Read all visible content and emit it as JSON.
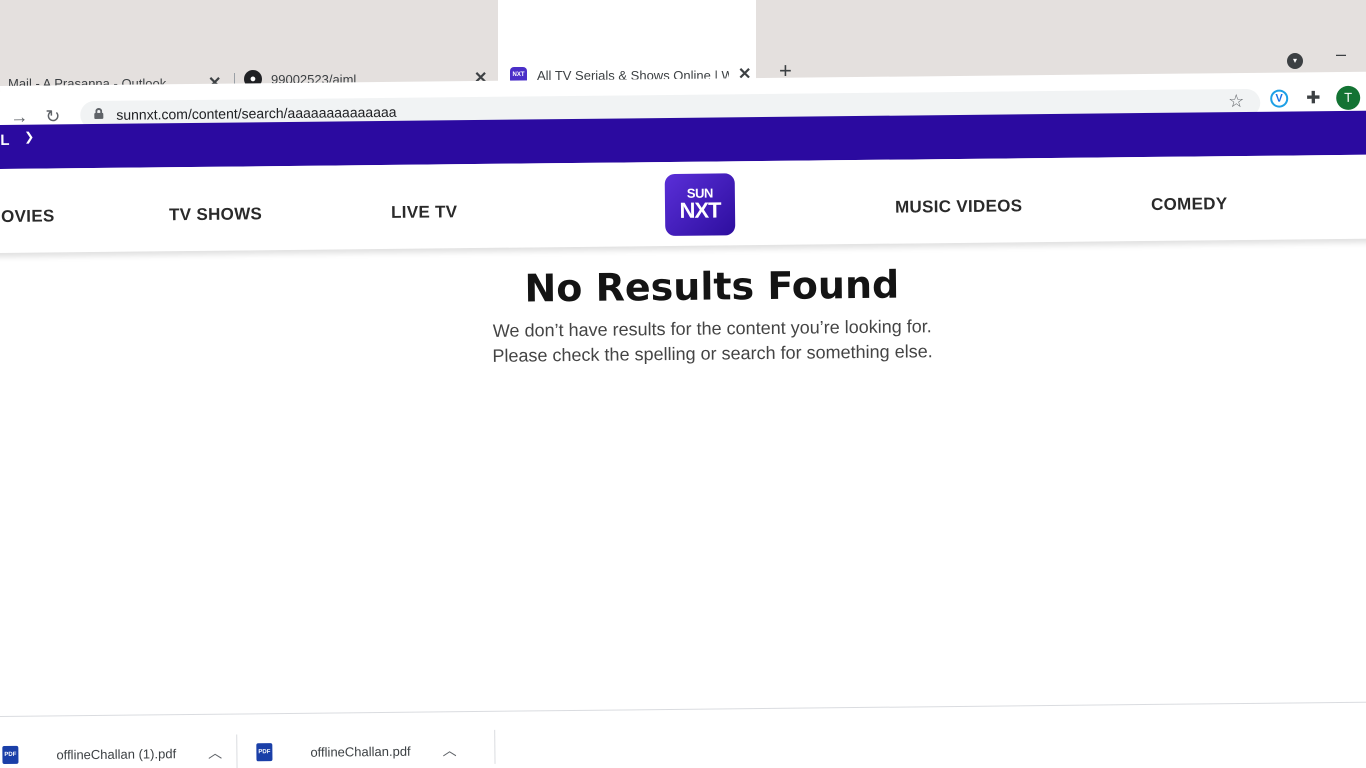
{
  "browser": {
    "tabs": [
      {
        "title": "Mail - A Prasanna - Outlook",
        "close": "✕"
      },
      {
        "title": "99002523/aiml",
        "close": "✕"
      },
      {
        "title": "All TV Serials & Shows Online | W",
        "close": "✕"
      }
    ],
    "new_tab": "+",
    "url": "sunnxt.com/content/search/aaaaaaaaaaaaaa",
    "profile_initial": "T",
    "extension_letter": "V"
  },
  "site": {
    "language_label": "L",
    "nav": {
      "movies": "OVIES",
      "tv_shows": "TV SHOWS",
      "live_tv": "LIVE TV",
      "music_videos": "MUSIC VIDEOS",
      "comedy": "COMEDY"
    },
    "logo_top": "SUN",
    "logo_bottom": "NXT"
  },
  "results": {
    "title": "No Results Found",
    "line1": "We don’t have results for the content you’re looking for.",
    "line2": "Please check the spelling or search for something else."
  },
  "downloads": [
    {
      "filename": "offlineChallan (1).pdf",
      "icon": "PDF"
    },
    {
      "filename": "offlineChallan.pdf",
      "icon": "PDF"
    }
  ],
  "colors": {
    "brand_purple": "#2b0aa0",
    "logo_purple": "#4a2fc8"
  }
}
